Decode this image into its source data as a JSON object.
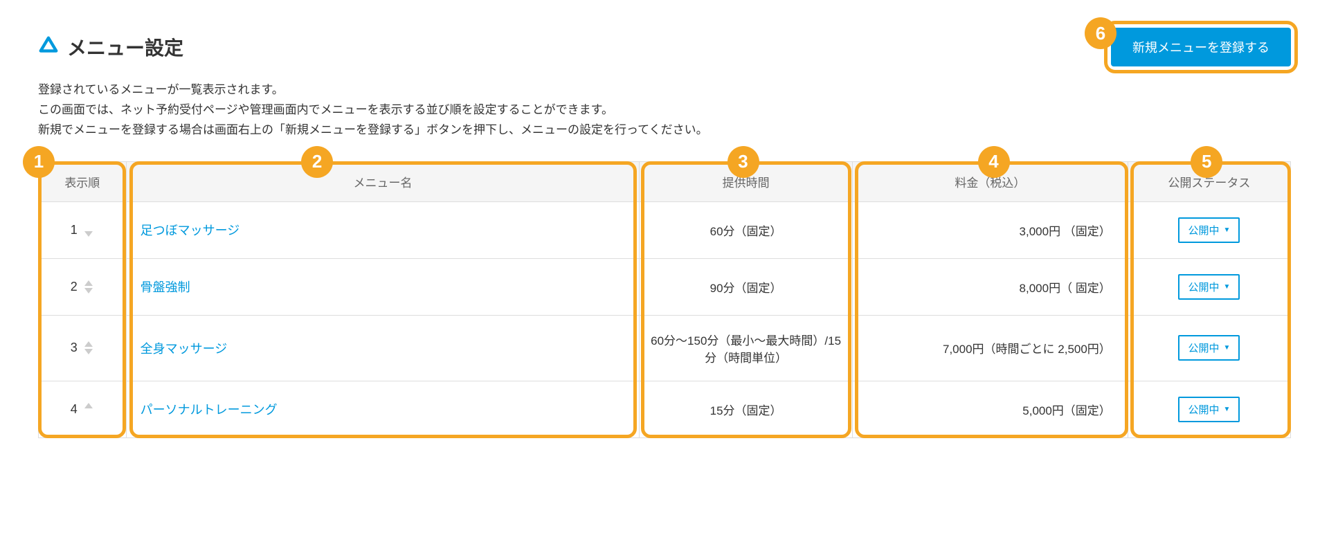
{
  "page_title": "メニュー設定",
  "primary_button_label": "新規メニューを登録する",
  "description_line1": "登録されているメニューが一覧表示されます。",
  "description_line2": "この画面では、ネット予約受付ページや管理画面内でメニューを表示する並び順を設定することができます。",
  "description_line3": "新規でメニューを登録する場合は画面右上の「新規メニューを登録する」ボタンを押下し、メニューの設定を行ってください。",
  "table": {
    "headers": {
      "order": "表示順",
      "name": "メニュー名",
      "time": "提供時間",
      "price": "料金（税込）",
      "status": "公開ステータス"
    },
    "rows": [
      {
        "order": "1",
        "name": "足つぼマッサージ",
        "time": "60分（固定）",
        "price": "3,000円 （固定）",
        "status": "公開中",
        "has_up": false,
        "has_down": true
      },
      {
        "order": "2",
        "name": "骨盤強制",
        "time": "90分（固定）",
        "price": "8,000円（ 固定）",
        "status": "公開中",
        "has_up": true,
        "has_down": true
      },
      {
        "order": "3",
        "name": "全身マッサージ",
        "time": "60分〜150分（最小〜最大時間）/15分（時間単位）",
        "price": "7,000円（時間ごとに 2,500円）",
        "status": "公開中",
        "has_up": true,
        "has_down": true
      },
      {
        "order": "4",
        "name": "パーソナルトレーニング",
        "time": "15分（固定）",
        "price": "5,000円（固定）",
        "status": "公開中",
        "has_up": true,
        "has_down": false
      }
    ]
  },
  "annotations": {
    "b1": "1",
    "b2": "2",
    "b3": "3",
    "b4": "4",
    "b5": "5",
    "b6": "6"
  }
}
